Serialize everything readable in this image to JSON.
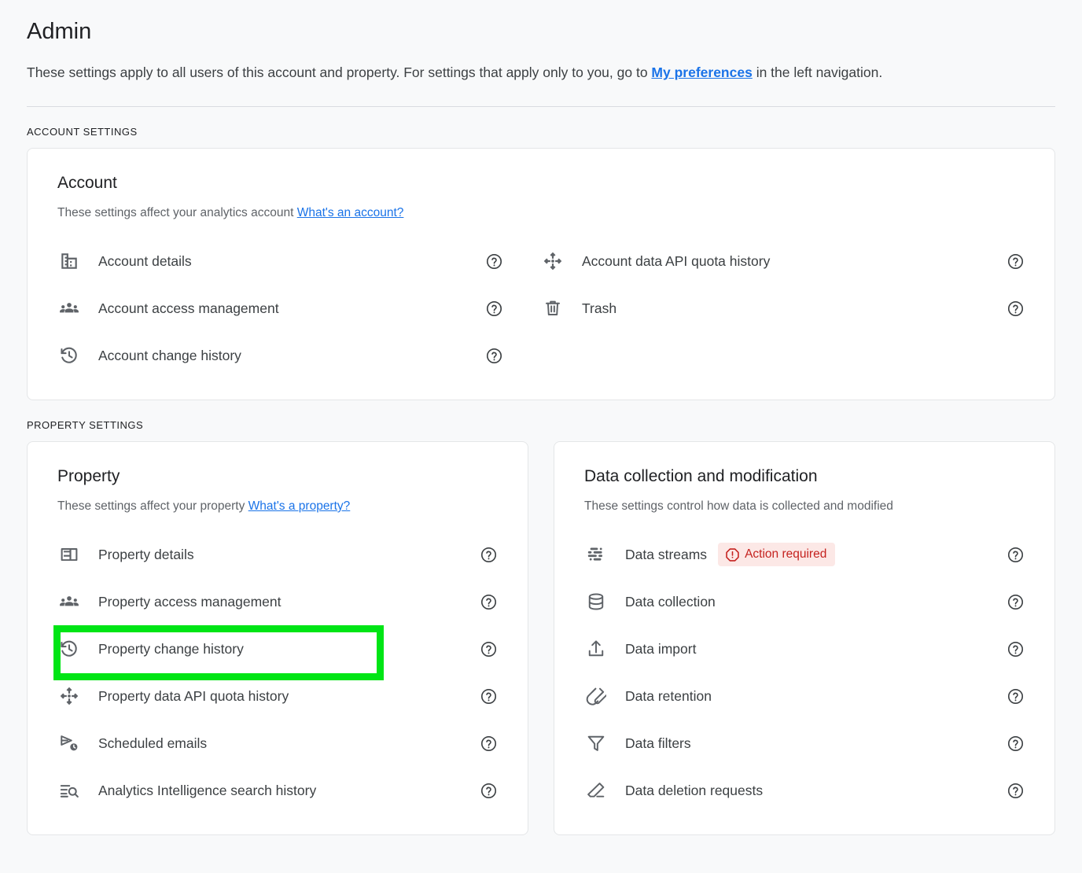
{
  "header": {
    "title": "Admin",
    "subtitle_before": "These settings apply to all users of this account and property. For settings that apply only to you, go to ",
    "subtitle_link": "My preferences",
    "subtitle_after": " in the left navigation."
  },
  "sections": {
    "account_settings_label": "ACCOUNT SETTINGS",
    "property_settings_label": "PROPERTY SETTINGS"
  },
  "account_card": {
    "title": "Account",
    "desc_text": "These settings affect your analytics account ",
    "desc_link": "What's an account?",
    "left_items": [
      {
        "label": "Account details",
        "icon": "building-icon",
        "help": "help-icon"
      },
      {
        "label": "Account access management",
        "icon": "people-icon",
        "help": "help-icon"
      },
      {
        "label": "Account change history",
        "icon": "history-icon",
        "help": "help-icon"
      }
    ],
    "right_items": [
      {
        "label": "Account data API quota history",
        "icon": "quota-diamond-icon",
        "help": "help-icon"
      },
      {
        "label": "Trash",
        "icon": "trash-icon",
        "help": "help-icon"
      }
    ]
  },
  "property_card": {
    "title": "Property",
    "desc_text": "These settings affect your property ",
    "desc_link": "What's a property?",
    "items": [
      {
        "label": "Property details",
        "icon": "property-details-icon",
        "help": "help-icon",
        "highlighted": false
      },
      {
        "label": "Property access management",
        "icon": "people-icon",
        "help": "help-icon",
        "highlighted": false
      },
      {
        "label": "Property change history",
        "icon": "history-icon",
        "help": "help-icon",
        "highlighted": true
      },
      {
        "label": "Property data API quota history",
        "icon": "quota-diamond-icon",
        "help": "help-icon",
        "highlighted": false
      },
      {
        "label": "Scheduled emails",
        "icon": "scheduled-send-icon",
        "help": "help-icon",
        "highlighted": false
      },
      {
        "label": "Analytics Intelligence search history",
        "icon": "search-history-icon",
        "help": "help-icon",
        "highlighted": false
      }
    ]
  },
  "data_card": {
    "title": "Data collection and modification",
    "desc_text": "These settings control how data is collected and modified",
    "items": [
      {
        "label": "Data streams",
        "icon": "data-streams-icon",
        "help": "help-icon",
        "badge": "Action required"
      },
      {
        "label": "Data collection",
        "icon": "database-icon",
        "help": "help-icon",
        "badge": null
      },
      {
        "label": "Data import",
        "icon": "upload-icon",
        "help": "help-icon",
        "badge": null
      },
      {
        "label": "Data retention",
        "icon": "magnet-icon",
        "help": "help-icon",
        "badge": null
      },
      {
        "label": "Data filters",
        "icon": "funnel-icon",
        "help": "help-icon",
        "badge": null
      },
      {
        "label": "Data deletion requests",
        "icon": "eraser-icon",
        "help": "help-icon",
        "badge": null
      }
    ]
  },
  "colors": {
    "background": "#F8F9FA",
    "card": "#FFFFFF",
    "link": "#1A73E8",
    "text_primary": "#202124",
    "text_secondary": "#5F6368",
    "badge_bg": "#FCE8E6",
    "badge_fg": "#C5221F",
    "highlight": "#00E515"
  }
}
